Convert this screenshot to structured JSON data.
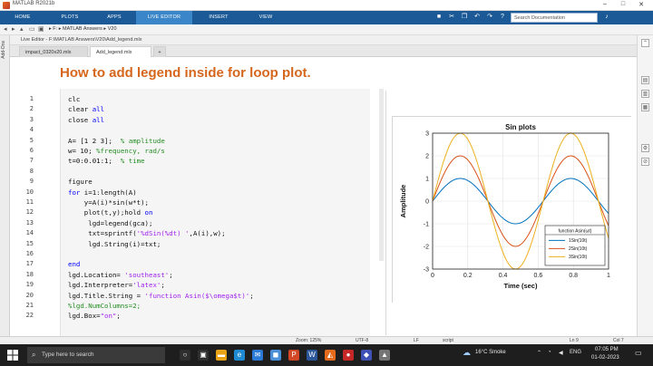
{
  "window": {
    "title": "MATLAB R2021b"
  },
  "ribbon": {
    "tabs": [
      "HOME",
      "PLOTS",
      "APPS",
      "LIVE EDITOR",
      "INSERT",
      "VIEW"
    ],
    "active_tab": "LIVE EDITOR",
    "search_placeholder": "Search Documentation"
  },
  "address": {
    "path": "▸ F: ▸ MATLAB Answers ▸ V20"
  },
  "side_panel": {
    "label": "Add-Ons"
  },
  "editor": {
    "header": "Live Editor - F:\\MATLAB Answers\\V20\\Add_legend.mlx",
    "tabs": [
      "impact_0320x20.mlx",
      "Add_legend.mlx"
    ],
    "active_tab": "Add_legend.mlx",
    "add_tab": "+",
    "heading": "How to add legend inside for loop plot.",
    "lines": [
      {
        "n": "1",
        "html": "clc"
      },
      {
        "n": "2",
        "html": "clear <span class='kw'>all</span>"
      },
      {
        "n": "3",
        "html": "close <span class='kw'>all</span>"
      },
      {
        "n": "4",
        "html": ""
      },
      {
        "n": "5",
        "html": "A= [1 2 3];  <span class='cm'>% amplitude</span>"
      },
      {
        "n": "6",
        "html": "w= 10; <span class='cm'>%frequency, rad/s</span>"
      },
      {
        "n": "7",
        "html": "t=0:0.01:1;  <span class='cm'>% time</span>"
      },
      {
        "n": "8",
        "html": ""
      },
      {
        "n": "9",
        "html": "figure"
      },
      {
        "n": "10",
        "html": "<span class='kw'>for</span> i=1:length(A)"
      },
      {
        "n": "11",
        "html": "    y=A(i)*sin(w*t);"
      },
      {
        "n": "12",
        "html": "    plot(t,y);hold <span class='kw'>on</span>"
      },
      {
        "n": "13",
        "html": "     lgd=legend(gca);"
      },
      {
        "n": "14",
        "html": "     txt=sprintf(<span class='st'>'%dSin(%dt) '</span>,A(i),w);"
      },
      {
        "n": "15",
        "html": "     lgd.String(i)=txt;"
      },
      {
        "n": "16",
        "html": ""
      },
      {
        "n": "17",
        "html": "<span class='kw'>end</span>"
      },
      {
        "n": "18",
        "html": "lgd.Location= <span class='st'>'southeast'</span>;"
      },
      {
        "n": "19",
        "html": "lgd.Interpreter=<span class='st'>'latex'</span>;"
      },
      {
        "n": "20",
        "html": "lgd.Title.String = <span class='st'>'function Asin($\\omega$t)'</span>;"
      },
      {
        "n": "21",
        "html": "<span class='cm'>%lgd.NumColumns=2;</span>"
      },
      {
        "n": "22",
        "html": "lgd.Box=<span class='st'>\"on\"</span>;"
      }
    ]
  },
  "chart_data": {
    "type": "line",
    "title": "Sin plots",
    "xlabel": "Time (sec)",
    "ylabel": "Amplitude",
    "xlim": [
      0,
      1
    ],
    "ylim": [
      -3,
      3
    ],
    "xticks": [
      "0",
      "0.2",
      "0.4",
      "0.6",
      "0.8",
      "1"
    ],
    "yticks": [
      "3",
      "2",
      "1",
      "0",
      "-1",
      "-2",
      "-3"
    ],
    "grid": true,
    "legend_location": "southeast",
    "legend_title": "function Asin(ωt)",
    "series": [
      {
        "name": "1Sin(10t)",
        "amplitude": 1,
        "omega": 10,
        "color": "#0072bd"
      },
      {
        "name": "2Sin(10t)",
        "amplitude": 2,
        "omega": 10,
        "color": "#d95319"
      },
      {
        "name": "3Sin(10t)",
        "amplitude": 3,
        "omega": 10,
        "color": "#edb120"
      }
    ]
  },
  "status": {
    "zoom": "Zoom: 125%",
    "encoding": "UTF-8",
    "eol": "LF",
    "mode": "script",
    "ln": "Ln  9",
    "col": "Col  7"
  },
  "taskbar": {
    "search_placeholder": "Type here to search",
    "weather": "16°C  Smoke",
    "lang": "ENG",
    "time": "07:05 PM",
    "date": "01-02-2023"
  }
}
